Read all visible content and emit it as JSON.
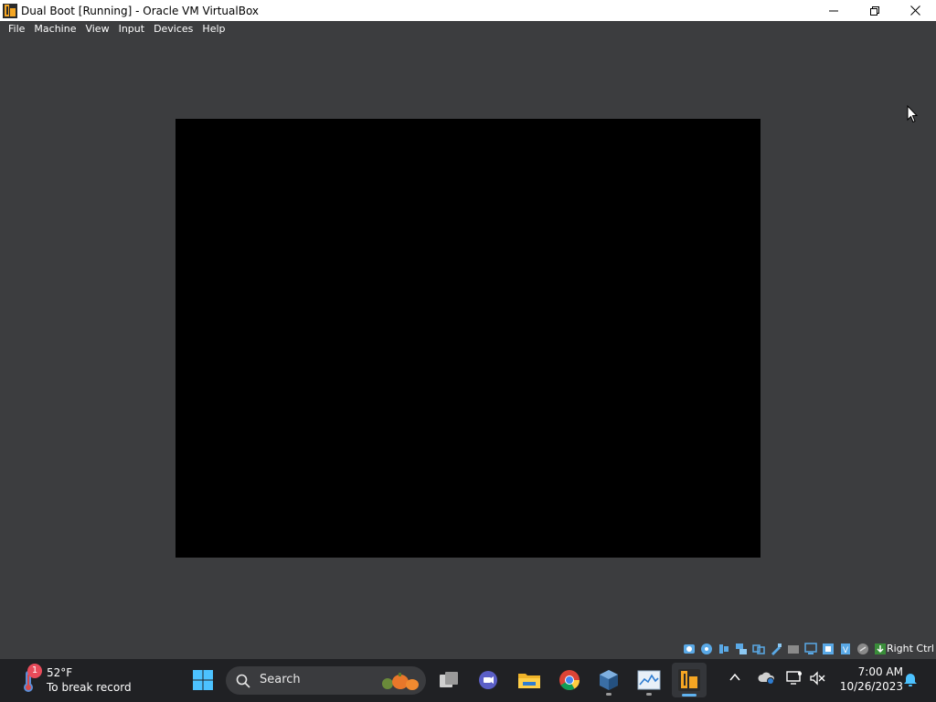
{
  "window": {
    "title": "Dual Boot [Running] - Oracle VM VirtualBox"
  },
  "menu": {
    "items": [
      "File",
      "Machine",
      "View",
      "Input",
      "Devices",
      "Help"
    ]
  },
  "statusbar": {
    "host_key": "Right Ctrl",
    "icons": [
      "hard-disk-icon",
      "optical-drive-icon",
      "audio-icon",
      "network-icon",
      "usb-icon",
      "shared-folders-icon",
      "display-icon",
      "recording-icon",
      "virtualization-icon",
      "mouse-integration-icon",
      "keyboard-icon"
    ]
  },
  "taskbar": {
    "weather": {
      "badge": "1",
      "temperature": "52°F",
      "description": "To break record"
    },
    "search": {
      "label": "Search"
    },
    "apps": [
      "windows-start-icon",
      "task-view-icon",
      "teams-chat-icon",
      "file-explorer-icon",
      "chrome-icon",
      "virtualbox-icon",
      "task-manager-icon",
      "virtualbox-vm-icon"
    ]
  },
  "tray": {
    "time": "7:00 AM",
    "date": "10/26/2023"
  },
  "colors": {
    "vm_background": "#3c3d3f",
    "vm_screen": "#000000",
    "taskbar": "#202124",
    "accent": "#5fb3f0"
  }
}
